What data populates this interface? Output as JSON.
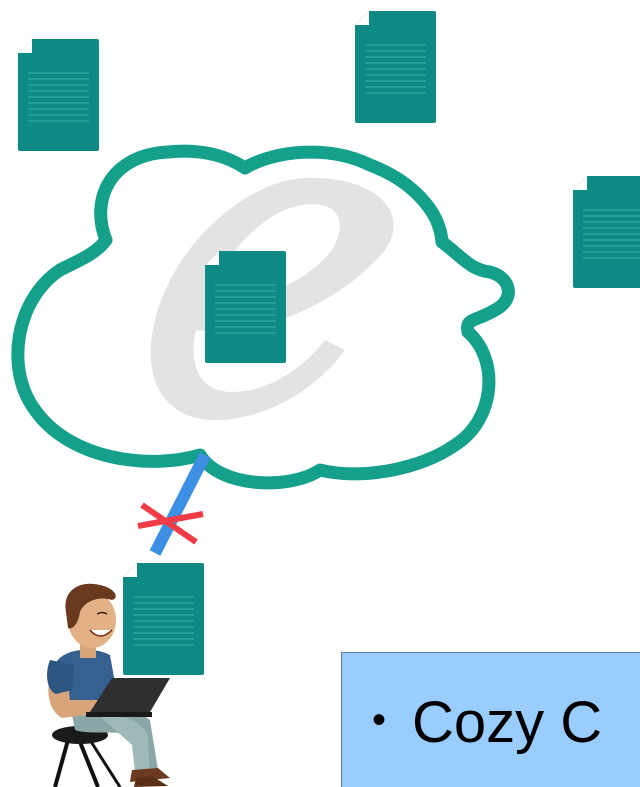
{
  "bullet": {
    "marker": "•",
    "text": "Cozy C"
  },
  "colors": {
    "doc_fill": "#0d8a83",
    "doc_fold": "#0a6e69",
    "cloud_stroke": "#14a08a",
    "logo_gray": "#e3e3e3",
    "link_blue": "#3d8fe3",
    "broken_mark": "#f03c46",
    "panel_bg": "#99ccff"
  },
  "icons": {
    "document": "document-icon",
    "cloud": "cloud-icon",
    "logo": "e-logo-icon",
    "broken_link": "broken-link-x-icon",
    "user": "user-with-laptop-icon"
  }
}
